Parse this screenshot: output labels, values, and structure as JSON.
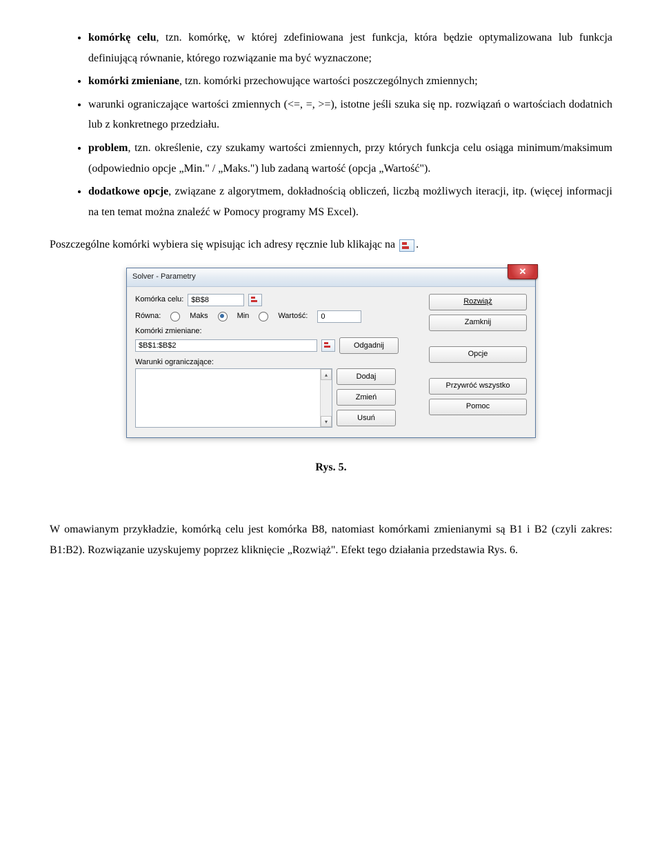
{
  "bullets": {
    "b1a": "komórkę celu",
    "b1b": ", tzn. komórkę, w której zdefiniowana jest funkcja, która będzie optymalizowana lub funkcja definiującą równanie, którego rozwiązanie ma być wyznaczone;",
    "b2a": "komórki zmieniane",
    "b2b": ", tzn. komórki przechowujące wartości poszczególnych zmiennych;",
    "b3": "warunki ograniczające wartości zmiennych (<=, =, >=), istotne jeśli szuka się np. rozwiązań o wartościach dodatnich lub z konkretnego przedziału.",
    "b4a": "problem",
    "b4b": ", tzn. określenie, czy szukamy wartości zmiennych, przy których funkcja celu osiąga minimum/maksimum (odpowiednio opcje „Min.\" / „Maks.\") lub zadaną wartość (opcja „Wartość\").",
    "b5a": "dodatkowe opcje",
    "b5b": ", związane z algorytmem, dokładnością obliczeń, liczbą możliwych iteracji, itp. (więcej informacji na ten temat można znaleźć w Pomocy programy MS Excel)."
  },
  "para1a": "Poszczególne komórki wybiera się wpisując ich adresy ręcznie lub klikając na ",
  "para1b": ".",
  "dialog": {
    "title": "Solver - Parametry",
    "lbl_cell": "Komórka celu:",
    "cell_val": "$B$8",
    "lbl_eq": "Równa:",
    "r_maks": "Maks",
    "r_min": "Min",
    "r_wart": "Wartość:",
    "wart_val": "0",
    "lbl_changing": "Komórki zmieniane:",
    "changing_val": "$B$1:$B$2",
    "btn_odgadnij": "Odgadnij",
    "lbl_constraints": "Warunki ograniczające:",
    "btn_dodaj": "Dodaj",
    "btn_zmien": "Zmień",
    "btn_usun": "Usuń",
    "btn_rozwiaz": "Rozwiąż",
    "btn_zamknij": "Zamknij",
    "btn_opcje": "Opcje",
    "btn_przywroc": "Przywróć wszystko",
    "btn_pomoc": "Pomoc"
  },
  "caption": "Rys. 5.",
  "para2": "W omawianym przykładzie, komórką celu jest komórka B8, natomiast komórkami zmienianymi są B1 i B2 (czyli zakres: B1:B2). Rozwiązanie uzyskujemy poprzez kliknięcie „Rozwiąż\". Efekt tego działania przedstawia Rys. 6."
}
